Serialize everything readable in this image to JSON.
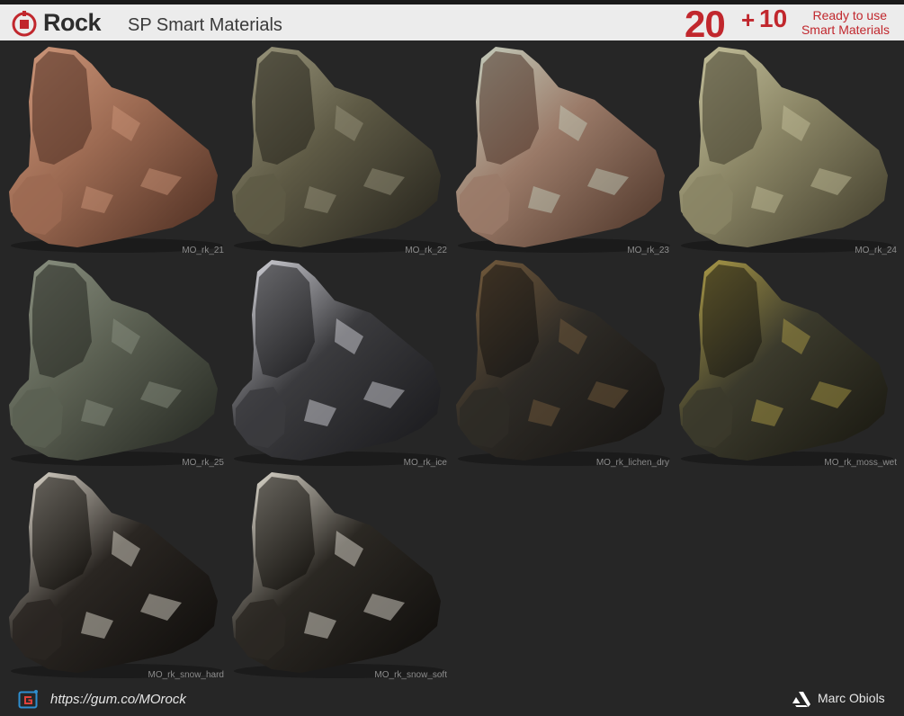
{
  "header": {
    "title": "Rock",
    "subtitle": "SP Smart Materials",
    "count_main": "20",
    "count_plus": "+",
    "count_extra": "10",
    "ready_line1": "Ready to use",
    "ready_line2": "Smart Materials",
    "accent_color": "#c1272d",
    "logo_icon": "substance-painter-logo-icon"
  },
  "materials": [
    {
      "name": "MO_rk_21",
      "base": "#9c6a52",
      "hi": "#d19a7d",
      "shade": "#4a2c20"
    },
    {
      "name": "MO_rk_22",
      "base": "#5e5a45",
      "hi": "#9e9a80",
      "shade": "#23211a"
    },
    {
      "name": "MO_rk_23",
      "base": "#9a7a68",
      "hi": "#c8d4c4",
      "shade": "#4a3226"
    },
    {
      "name": "MO_rk_24",
      "base": "#8a8565",
      "hi": "#c9c5a0",
      "shade": "#3e3a29"
    },
    {
      "name": "MO_rk_25",
      "base": "#5b6052",
      "hi": "#8e9484",
      "shade": "#22251f"
    },
    {
      "name": "MO_rk_ice",
      "base": "#3b3b3e",
      "hi": "#e0e0e6",
      "shade": "#17171a"
    },
    {
      "name": "MO_rk_lichen_dry",
      "base": "#2e2b26",
      "hi": "#7a5f3e",
      "shade": "#141210"
    },
    {
      "name": "MO_rk_moss_wet",
      "base": "#3b3a2c",
      "hi": "#b5a34a",
      "shade": "#17160f"
    },
    {
      "name": "MO_rk_snow_hard",
      "base": "#2a2622",
      "hi": "#ece6da",
      "shade": "#0e0c0a"
    },
    {
      "name": "MO_rk_snow_soft",
      "base": "#2b2823",
      "hi": "#f0ebdf",
      "shade": "#0e0c0a"
    }
  ],
  "footer": {
    "link": "https://gum.co/MOrock",
    "link_icon": "gumroad-icon",
    "author": "Marc Obiols",
    "author_icon": "artstation-icon"
  }
}
